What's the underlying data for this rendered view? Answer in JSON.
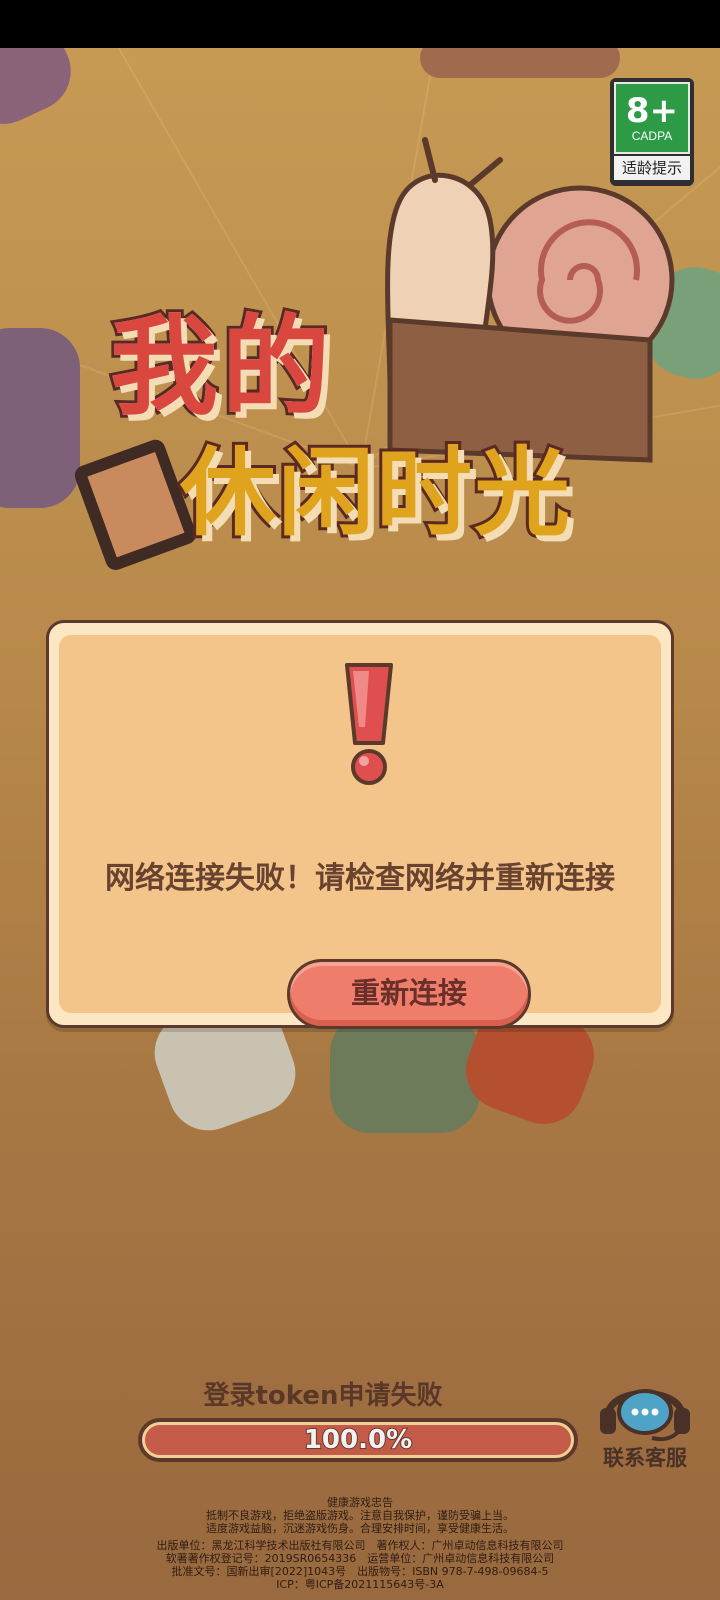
{
  "age_rating": {
    "rating": "8+",
    "org": "CADPA",
    "caption": "适龄提示"
  },
  "logo": {
    "line1": "我的",
    "line2": "休闲时光"
  },
  "dialog": {
    "message": "网络连接失败！请检查网络并重新连接",
    "button_label": "重新连接"
  },
  "loading": {
    "status_text": "登录token申请失败",
    "progress": 1.0,
    "progress_text": "100.0%"
  },
  "support": {
    "label": "联系客服"
  },
  "notice": {
    "title": "健康游戏忠告",
    "lines": [
      "抵制不良游戏，拒绝盗版游戏。注意自我保护，谨防受骗上当。",
      "适度游戏益脑，沉迷游戏伤身。合理安排时间，享受健康生活。"
    ],
    "publisher_lines": [
      "出版单位：黑龙江科学技术出版社有限公司　著作权人：广州卓动信息科技有限公司",
      "软著著作权登记号：2019SR0654336　运营单位：广州卓动信息科技有限公司",
      "批准文号：国新出审[2022]1043号　出版物号：ISBN 978-7-498-09684-5",
      "ICP：粤ICP备2021115643号-3A"
    ]
  },
  "colors": {
    "background": "#b07f45",
    "dialog_outer": "#fbe7c4",
    "dialog_inner": "#f3c58b",
    "button": "#ee7d6c",
    "outline": "#5b3a2b",
    "progress_fill": "#c45a48",
    "rating_green": "#2d9a46"
  },
  "icons": {
    "alert": "exclamation-icon",
    "support": "headset-chat-icon"
  }
}
